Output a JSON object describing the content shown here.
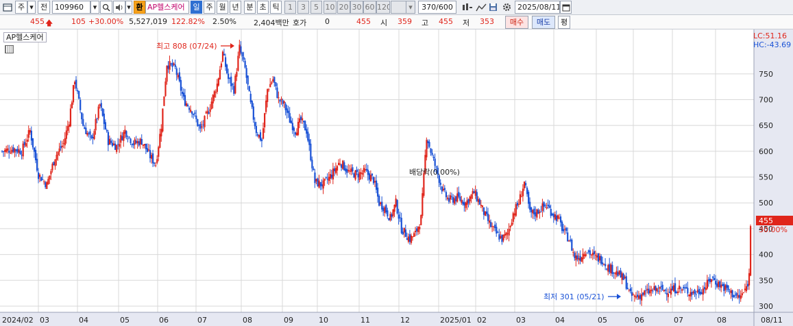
{
  "toolbar": {
    "market_type": "주",
    "prev_label": "전",
    "code": "109960",
    "name_badge": "환",
    "stock_name": "AP헬스케어",
    "periods": [
      "일",
      "주",
      "월",
      "년",
      "분",
      "초",
      "틱"
    ],
    "minutes": [
      "1",
      "3",
      "5",
      "10",
      "20",
      "30",
      "60",
      "120"
    ],
    "count": "370/600",
    "date": "2025/08/11",
    "icons": [
      "window-icon",
      "dropdown-icon",
      "search-icon",
      "speaker-icon",
      "chart-settings-icon",
      "save-icon",
      "gear-icon",
      "calendar-icon"
    ]
  },
  "quote": {
    "price": "455",
    "change": "105",
    "change_pct": "+30.00%",
    "volume": "5,527,019",
    "volume_ratio": "122.82%",
    "rate": "2.50%",
    "amount": "2,404백만",
    "hoga_label": "호가",
    "hoga_value": "0",
    "hoga_price": "455",
    "open_label": "시",
    "open": "359",
    "high_label": "고",
    "high": "455",
    "low_label": "저",
    "low": "353",
    "buy_label": "매수",
    "sell_label": "매도",
    "avg_label": "평"
  },
  "chart": {
    "legend": "AP헬스케어",
    "lc_label": "LC:51.16",
    "hc_label": "HC:-43.69",
    "high_annotation": "최고 808 (07/24)",
    "low_annotation": "최저 301 (05/21)",
    "dividend_annotation": "배당락(0.00%)",
    "last_price_tag": "455",
    "last_pct_tag": "30.00%",
    "colors": {
      "up": "#e0251b",
      "down": "#1a52d6",
      "axis_bg": "#e6e8f2",
      "grid": "#d8d8d8"
    }
  },
  "chart_data": {
    "type": "candlestick",
    "y_ticks": [
      300,
      350,
      400,
      450,
      500,
      550,
      600,
      650,
      700,
      750
    ],
    "ylim": [
      288,
      836
    ],
    "x_labels": [
      "2024/02",
      "03",
      "04",
      "05",
      "06",
      "07",
      "08",
      "09",
      "10",
      "11",
      "12",
      "2025/01",
      "02",
      "03",
      "04",
      "05",
      "06",
      "07",
      "08",
      "08/11"
    ],
    "series": [
      {
        "name": "close",
        "anchors": [
          [
            0,
            600
          ],
          [
            8,
            605
          ],
          [
            14,
            600
          ],
          [
            20,
            640
          ],
          [
            26,
            555
          ],
          [
            32,
            535
          ],
          [
            38,
            590
          ],
          [
            44,
            615
          ],
          [
            48,
            660
          ],
          [
            52,
            740
          ],
          [
            58,
            650
          ],
          [
            64,
            620
          ],
          [
            70,
            690
          ],
          [
            76,
            620
          ],
          [
            82,
            610
          ],
          [
            88,
            640
          ],
          [
            94,
            615
          ],
          [
            100,
            620
          ],
          [
            106,
            590
          ],
          [
            110,
            575
          ],
          [
            114,
            650
          ],
          [
            118,
            770
          ],
          [
            124,
            760
          ],
          [
            130,
            700
          ],
          [
            136,
            680
          ],
          [
            142,
            640
          ],
          [
            148,
            680
          ],
          [
            154,
            730
          ],
          [
            158,
            790
          ],
          [
            162,
            740
          ],
          [
            166,
            720
          ],
          [
            170,
            800
          ],
          [
            174,
            760
          ],
          [
            178,
            690
          ],
          [
            182,
            640
          ],
          [
            186,
            620
          ],
          [
            190,
            720
          ],
          [
            194,
            740
          ],
          [
            198,
            700
          ],
          [
            202,
            690
          ],
          [
            206,
            660
          ],
          [
            210,
            640
          ],
          [
            214,
            660
          ],
          [
            218,
            640
          ],
          [
            224,
            540
          ],
          [
            230,
            535
          ],
          [
            236,
            555
          ],
          [
            242,
            580
          ],
          [
            248,
            560
          ],
          [
            254,
            555
          ],
          [
            260,
            560
          ],
          [
            266,
            545
          ],
          [
            270,
            500
          ],
          [
            274,
            490
          ],
          [
            278,
            470
          ],
          [
            282,
            500
          ],
          [
            286,
            450
          ],
          [
            292,
            430
          ],
          [
            296,
            440
          ],
          [
            300,
            470
          ],
          [
            304,
            630
          ],
          [
            308,
            590
          ],
          [
            312,
            555
          ],
          [
            316,
            520
          ],
          [
            320,
            505
          ],
          [
            326,
            510
          ],
          [
            332,
            500
          ],
          [
            338,
            520
          ],
          [
            342,
            500
          ],
          [
            346,
            475
          ],
          [
            350,
            455
          ],
          [
            354,
            440
          ],
          [
            358,
            430
          ],
          [
            362,
            440
          ],
          [
            366,
            480
          ],
          [
            370,
            500
          ],
          [
            374,
            540
          ],
          [
            378,
            480
          ],
          [
            382,
            480
          ],
          [
            386,
            490
          ],
          [
            390,
            495
          ],
          [
            394,
            480
          ],
          [
            398,
            470
          ],
          [
            402,
            445
          ],
          [
            406,
            430
          ],
          [
            410,
            395
          ],
          [
            414,
            395
          ],
          [
            418,
            410
          ],
          [
            424,
            395
          ],
          [
            430,
            390
          ],
          [
            434,
            375
          ],
          [
            438,
            370
          ],
          [
            442,
            360
          ],
          [
            446,
            350
          ],
          [
            450,
            320
          ],
          [
            454,
            318
          ],
          [
            460,
            325
          ],
          [
            466,
            330
          ],
          [
            472,
            332
          ],
          [
            478,
            330
          ],
          [
            484,
            335
          ],
          [
            490,
            330
          ],
          [
            496,
            325
          ],
          [
            500,
            330
          ],
          [
            504,
            338
          ],
          [
            508,
            355
          ],
          [
            512,
            345
          ],
          [
            516,
            338
          ],
          [
            520,
            330
          ],
          [
            524,
            322
          ],
          [
            528,
            316
          ],
          [
            532,
            330
          ],
          [
            534,
            345
          ],
          [
            535,
            360
          ],
          [
            536,
            455
          ]
        ]
      }
    ]
  }
}
